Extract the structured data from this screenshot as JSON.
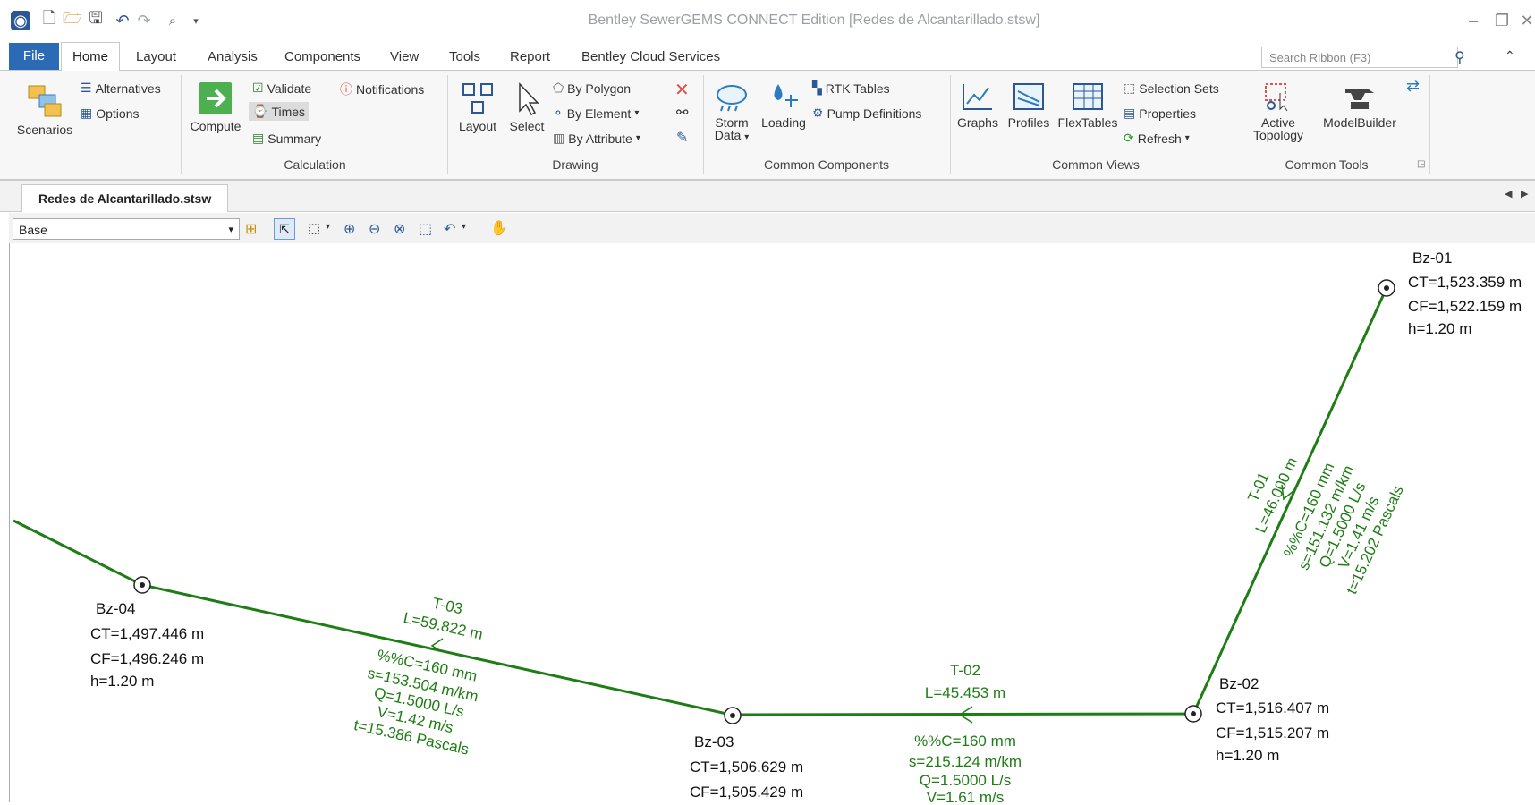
{
  "app": {
    "title": "Bentley SewerGEMS CONNECT Edition [Redes de Alcantarillado.stsw]"
  },
  "quick_access": {
    "icons": [
      "app-logo-icon",
      "new-icon",
      "open-icon",
      "save-icon",
      "undo-icon",
      "redo-icon",
      "print-preview-icon",
      "dropdown-icon"
    ]
  },
  "tabs": [
    "File",
    "Home",
    "Layout",
    "Analysis",
    "Components",
    "View",
    "Tools",
    "Report",
    "Bentley Cloud Services"
  ],
  "search": {
    "placeholder": "Search Ribbon (F3)"
  },
  "ribbon": {
    "scenarios": {
      "label": "Scenarios",
      "alternatives": "Alternatives",
      "options": "Options"
    },
    "calculation": {
      "group": "Calculation",
      "compute": "Compute",
      "validate": "Validate",
      "times": "Times",
      "summary": "Summary",
      "notifications": "Notifications"
    },
    "drawing": {
      "group": "Drawing",
      "layout": "Layout",
      "select": "Select",
      "by_polygon": "By Polygon",
      "by_element": "By Element",
      "by_attribute": "By Attribute"
    },
    "common_components": {
      "group": "Common Components",
      "storm_data": "Storm",
      "storm_data2": "Data",
      "loading": "Loading",
      "rtk_tables": "RTK Tables",
      "pump_definitions": "Pump Definitions"
    },
    "common_views": {
      "group": "Common Views",
      "graphs": "Graphs",
      "profiles": "Profiles",
      "flextables": "FlexTables",
      "selection_sets": "Selection Sets",
      "properties": "Properties",
      "refresh": "Refresh"
    },
    "common_tools": {
      "group": "Common Tools",
      "active_topology": "Active",
      "active_topology2": "Topology",
      "modelbuilder": "ModelBuilder"
    }
  },
  "document_tab": "Redes de Alcantarillado.stsw",
  "scenario_select": "Base",
  "network": {
    "link_color": "#1e7d14",
    "nodes": [
      {
        "id": "Bz-01",
        "ct": "CT=1,523.359 m",
        "cf": "CF=1,522.159 m",
        "h": "h=1.20 m"
      },
      {
        "id": "Bz-02",
        "ct": "CT=1,516.407 m",
        "cf": "CF=1,515.207 m",
        "h": "h=1.20 m"
      },
      {
        "id": "Bz-03",
        "ct": "CT=1,506.629 m",
        "cf": "CF=1,505.429 m",
        "h": ""
      },
      {
        "id": "Bz-04",
        "ct": "CT=1,497.446 m",
        "cf": "CF=1,496.246 m",
        "h": "h=1.20 m"
      }
    ],
    "links": [
      {
        "id": "T-01",
        "length": "L=46.000 m",
        "diameter": "%%C=160 mm",
        "slope": "s=151.132 m/km",
        "flow": "Q=1.5000 L/s",
        "velocity": "V=1.41 m/s",
        "tension": "t=15.202 Pascals"
      },
      {
        "id": "T-02",
        "length": "L=45.453 m",
        "diameter": "%%C=160 mm",
        "slope": "s=215.124 m/km",
        "flow": "Q=1.5000 L/s",
        "velocity": "V=1.61 m/s",
        "tension": ""
      },
      {
        "id": "T-03",
        "length": "L=59.822 m",
        "diameter": "%%C=160 mm",
        "slope": "s=153.504 m/km",
        "flow": "Q=1.5000 L/s",
        "velocity": "V=1.42 m/s",
        "tension": "t=15.386 Pascals"
      }
    ]
  }
}
